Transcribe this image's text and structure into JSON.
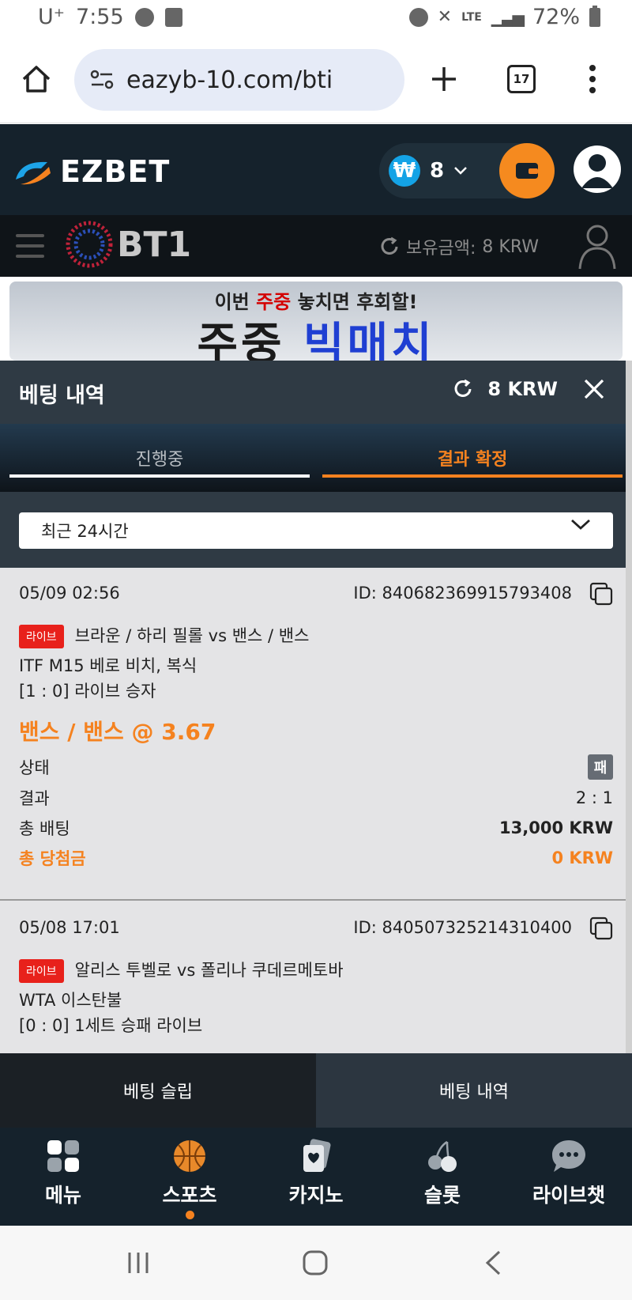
{
  "status_bar": {
    "carrier": "U⁺",
    "time": "7:55",
    "network": "LTE",
    "battery": "72%"
  },
  "browser": {
    "url": "eazyb-10.com/bti",
    "tab_count": "17"
  },
  "header": {
    "logo_text": "EZBET",
    "currency_symbol": "₩",
    "wallet_amount": "8"
  },
  "sub_header": {
    "logo_text": "BT1",
    "balance_label": "보유금액:",
    "balance_value": "8 KRW"
  },
  "banner": {
    "line1_pre": "이번 ",
    "line1_highlight": "주중",
    "line1_post": " 놓치면 후회할!",
    "line2_a": "주중 ",
    "line2_b": "빅매치"
  },
  "panel": {
    "title": "베팅 내역",
    "balance": "8 KRW",
    "tabs": [
      {
        "label": "진행중"
      },
      {
        "label": "결과 확정"
      }
    ],
    "filter_selected": "최근 24시간"
  },
  "bets": [
    {
      "datetime": "05/09 02:56",
      "id": "ID: 840682369915793408",
      "badge": "라이브",
      "match": "브라운 / 하리 필롤 vs 밴스 / 밴스",
      "league": "ITF M15 베로 비치, 복식",
      "market": "[1 : 0] 라이브 승자",
      "pick": "밴스 / 밴스 @ 3.67",
      "status_label": "상태",
      "status_value": "패",
      "result_label": "결과",
      "result_value": "2 : 1",
      "stake_label": "총 배팅",
      "stake_value": "13,000 KRW",
      "payout_label": "총 당첨금",
      "payout_value": "0 KRW"
    },
    {
      "datetime": "05/08 17:01",
      "id": "ID: 840507325214310400",
      "badge": "라이브",
      "match": "알리스 투벨로 vs 폴리나 쿠데르메토바",
      "league": "WTA 이스탄불",
      "market": "[0 : 0] 1세트 승패 라이브"
    }
  ],
  "bet_tabs": {
    "slip": "베팅 슬립",
    "history": "베팅 내역"
  },
  "bottom_nav": [
    {
      "label": "메뉴",
      "icon": "menu-grid-icon"
    },
    {
      "label": "스포츠",
      "icon": "basketball-icon"
    },
    {
      "label": "카지노",
      "icon": "cards-icon"
    },
    {
      "label": "슬롯",
      "icon": "cherry-icon"
    },
    {
      "label": "라이브챗",
      "icon": "chat-bubble-icon"
    }
  ],
  "colors": {
    "accent": "#f5821f",
    "header_bg": "#15222c",
    "live_badge": "#e8211b",
    "sheet_bg": "#e4e4e6"
  }
}
